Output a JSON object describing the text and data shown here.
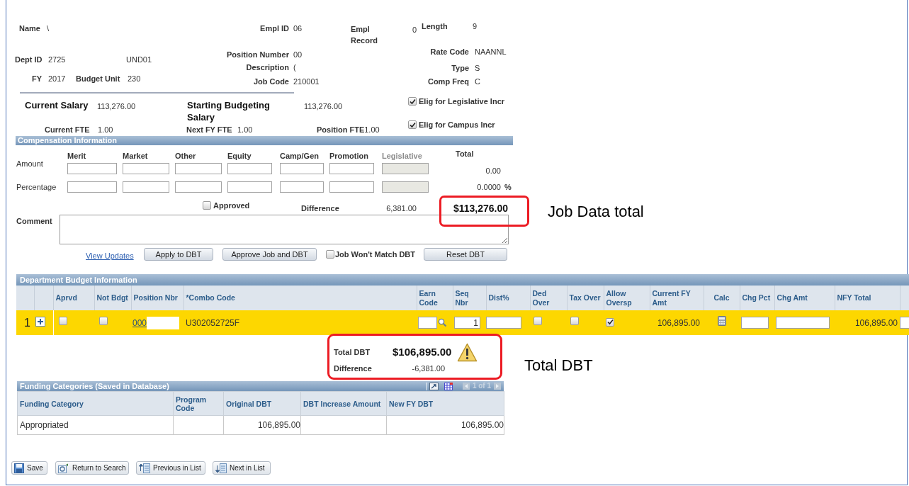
{
  "header": {
    "name": {
      "label": "Name",
      "value": "\\"
    },
    "empl_id": {
      "label": "Empl ID",
      "value": "06"
    },
    "empl_record": {
      "label": "Empl Record",
      "value": "0"
    },
    "length": {
      "label": "Length",
      "value": "9"
    },
    "dept_id": {
      "label": "Dept ID",
      "value": "2725",
      "description": "UND01"
    },
    "position_number": {
      "label": "Position Number",
      "value": "00"
    },
    "rate_code": {
      "label": "Rate Code",
      "value": "NAANNL"
    },
    "description": {
      "label": "Description",
      "value": "("
    },
    "type": {
      "label": "Type",
      "value": "S"
    },
    "fy": {
      "label": "FY",
      "value": "2017"
    },
    "budget_unit": {
      "label": "Budget Unit",
      "value": "230"
    },
    "job_code": {
      "label": "Job Code",
      "value": "210001"
    },
    "comp_freq": {
      "label": "Comp Freq",
      "value": "C"
    }
  },
  "salary": {
    "current_salary": {
      "label": "Current Salary",
      "value": "113,276.00"
    },
    "starting_budgeting_salary": {
      "label": "Starting Budgeting Salary",
      "value": "113,276.00"
    },
    "current_fte": {
      "label": "Current FTE",
      "value": "1.00"
    },
    "next_fy_fte": {
      "label": "Next FY FTE",
      "value": "1.00"
    },
    "position_fte": {
      "label": "Position FTE",
      "value": "1.00"
    },
    "elig_legislative_incr": {
      "label": "Elig for Legislative Incr",
      "checked": true
    },
    "elig_campus_incr": {
      "label": "Elig for Campus Incr",
      "checked": true
    }
  },
  "compensation": {
    "title": "Compensation Information",
    "columns": [
      {
        "label": "Merit",
        "disabled": false
      },
      {
        "label": "Market",
        "disabled": false
      },
      {
        "label": "Other",
        "disabled": false
      },
      {
        "label": "Equity",
        "disabled": false
      },
      {
        "label": "Camp/Gen",
        "disabled": false
      },
      {
        "label": "Promotion",
        "disabled": false
      },
      {
        "label": "Legislative",
        "disabled": true
      }
    ],
    "total_label": "Total",
    "rows": [
      {
        "label": "Amount",
        "total": "0.00"
      },
      {
        "label": "Percentage",
        "total": "0.0000",
        "unit": "%"
      }
    ],
    "approved": {
      "label": "Approved",
      "checked": false
    },
    "difference": {
      "label": "Difference",
      "value": "6,381.00"
    },
    "job_total": "$113,276.00",
    "comment": {
      "label": "Comment"
    },
    "actions": [
      {
        "kind": "link",
        "label": "View Updates"
      },
      {
        "kind": "button",
        "label": "Apply to DBT"
      },
      {
        "kind": "button",
        "label": "Approve Job and DBT"
      },
      {
        "kind": "checkbox",
        "label": "Job Won't Match DBT",
        "checked": false
      },
      {
        "kind": "button",
        "label": "Reset DBT"
      }
    ]
  },
  "department_budget": {
    "title": "Department Budget Information",
    "columns": [
      "Aprvd",
      "Not Bdgt",
      "Position Nbr",
      "*Combo Code",
      "Earn Code",
      "Seq Nbr",
      "Dist%",
      "Ded Over",
      "Tax Over",
      "Allow Oversp",
      "Current FY Amt",
      "Calc",
      "Chg Pct",
      "Chg Amt",
      "NFY Total"
    ],
    "rows": [
      {
        "row_number": "1",
        "selected": true,
        "aprvd": false,
        "not_bdgt": false,
        "position_nbr": "000",
        "combo_code": "U302052725F",
        "seq_nbr": "1",
        "ded_over": false,
        "tax_over": false,
        "allow_oversp": true,
        "current_fy_amt": "106,895.00",
        "nfy_total": "106,895.00"
      }
    ]
  },
  "totals": {
    "total_dbt": {
      "label": "Total DBT",
      "value": "$106,895.00"
    },
    "difference": {
      "label": "Difference",
      "value": "-6,381.00"
    }
  },
  "funding_categories": {
    "title": "Funding Categories (Saved in Database)",
    "pager": "1 of 1",
    "columns": [
      "Funding Category",
      "Program Code",
      "Original DBT",
      "DBT Increase Amount",
      "New FY DBT"
    ],
    "rows": [
      {
        "funding_category": "Appropriated",
        "original_dbt": "106,895.00",
        "new_fy_dbt": "106,895.00"
      }
    ]
  },
  "buttons": [
    {
      "kind": "save",
      "label": "Save"
    },
    {
      "kind": "return",
      "label": "Return to Search"
    },
    {
      "kind": "previous",
      "label": "Previous in List"
    },
    {
      "kind": "next",
      "label": "Next in List"
    }
  ],
  "annotations": [
    {
      "kind": "job_total",
      "text": "Job Data total"
    },
    {
      "kind": "totals",
      "text": "Total DBT"
    }
  ]
}
